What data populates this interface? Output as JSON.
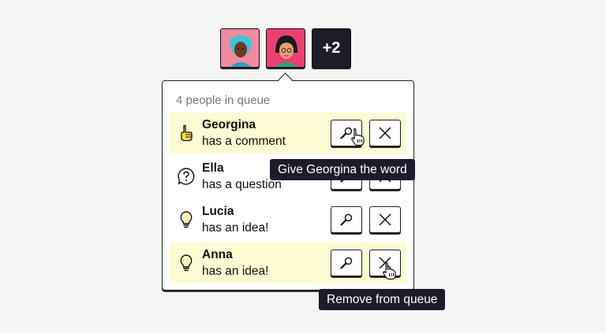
{
  "avatars": {
    "more_label": "+2",
    "colors": [
      "#f08aa0",
      "#ea3f72"
    ]
  },
  "queue": {
    "count_text": "4 people in queue",
    "items": [
      {
        "name": "Georgina",
        "status": "has a comment",
        "icon": "hand-pointing-icon",
        "highlighted": true
      },
      {
        "name": "Ella",
        "status": "has a question",
        "icon": "question-bubble-icon",
        "highlighted": false
      },
      {
        "name": "Lucia",
        "status": "has an idea!",
        "icon": "lightbulb-icon",
        "highlighted": false
      },
      {
        "name": "Anna",
        "status": "has an idea!",
        "icon": "lightbulb-icon",
        "highlighted": true
      }
    ]
  },
  "tooltips": {
    "give_word": "Give Georgina the word",
    "remove": "Remove from queue"
  },
  "colors": {
    "highlight": "#fdfbd3",
    "tooltip_bg": "#1c1c2a",
    "accent_yellow": "#f3e04a"
  }
}
